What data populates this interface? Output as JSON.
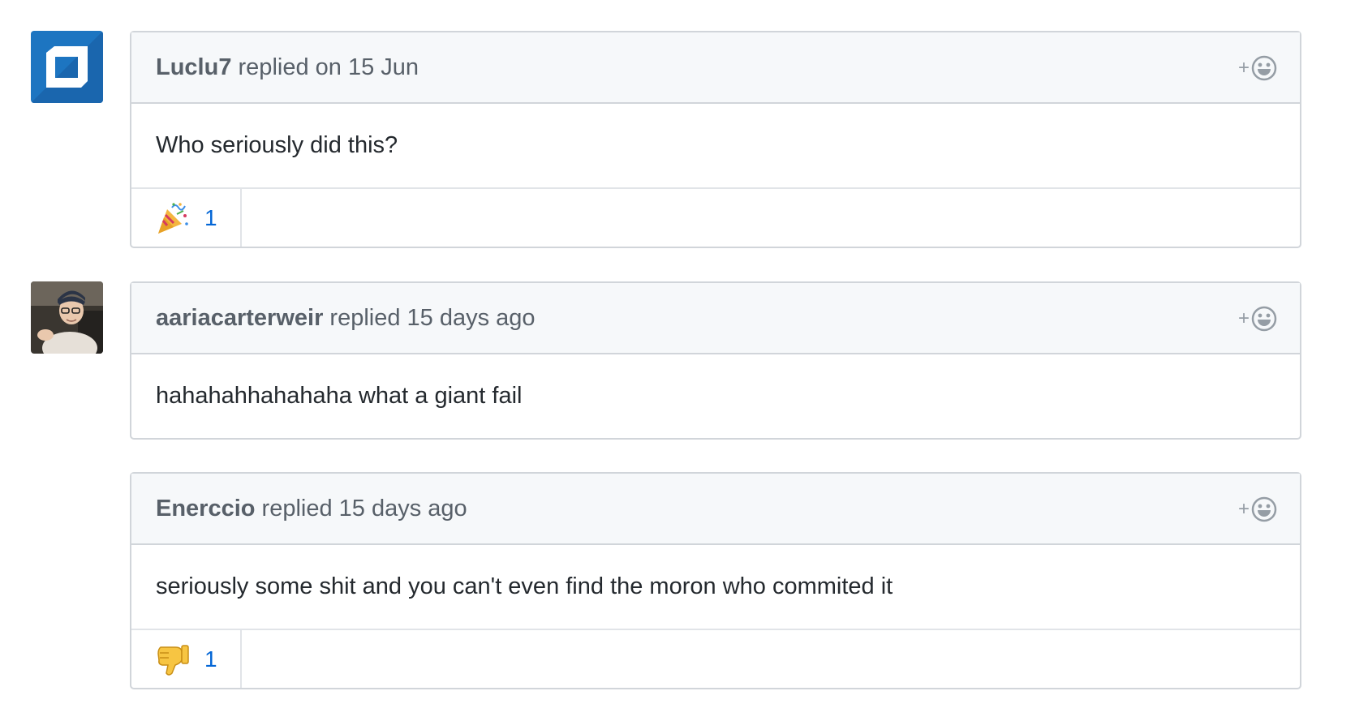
{
  "comments": [
    {
      "author": "Luclu7",
      "action": " replied on 15 Jun",
      "body": "Who seriously did this?",
      "reaction": {
        "emoji": "tada-icon",
        "count": "1"
      }
    },
    {
      "author": "aariacarterweir",
      "action": " replied 15 days ago",
      "body": "hahahahhahahaha what a giant fail"
    },
    {
      "author": "Enerccio",
      "action": " replied 15 days ago",
      "body": "seriously some shit and you can't even find the moron who commited it",
      "reaction": {
        "emoji": "thumbs-down-icon",
        "count": "1"
      }
    }
  ],
  "add_reaction_symbol": "+",
  "colors": {
    "link": "#0366d6",
    "border": "#d1d5da",
    "header_bg": "#f6f8fa",
    "avatar_blue": "#1d75c1"
  }
}
